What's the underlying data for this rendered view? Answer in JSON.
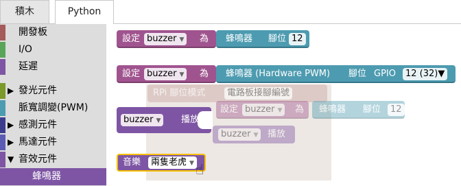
{
  "tabs": {
    "blocks": "積木",
    "python": "Python"
  },
  "toolbox": {
    "items": [
      {
        "label": "開發板",
        "color": "#a55b5b"
      },
      {
        "label": "I/O",
        "color": "#5ba55b"
      },
      {
        "label": "延遲",
        "color": "#7e55a4"
      },
      {
        "label": "發光元件",
        "color": "#7a9a2a",
        "expandable": true,
        "arrow": "▶"
      },
      {
        "label": "脈寬調變(PWM)",
        "color": "#4d9bb0"
      },
      {
        "label": "感測元件",
        "color": "#3d3d8f",
        "expandable": true,
        "arrow": "▶"
      },
      {
        "label": "馬達元件",
        "color": "#5b5bb5",
        "expandable": true,
        "arrow": "▶"
      },
      {
        "label": "音效元件",
        "color": "#7e55a4",
        "expandable": true,
        "arrow": "▼"
      }
    ],
    "selected_sub": "蜂鳴器"
  },
  "workspace": {
    "block1": {
      "set": "設定",
      "var": "buzzer",
      "as": "為",
      "device": "蜂鳴器",
      "pin_label": "腳位",
      "pin": "12"
    },
    "block2": {
      "set": "設定",
      "var": "buzzer",
      "as": "為",
      "device": "蜂鳴器 (Hardware PWM)",
      "pin_label": "腳位",
      "gpio_label": "GPIO",
      "gpio": "12 (32)"
    },
    "block3": {
      "var": "buzzer",
      "action": "播放"
    },
    "block4": {
      "label": "音樂",
      "song": "兩隻老虎"
    },
    "ghost": {
      "title": "RPi 腳位模式",
      "mode": "電路板接腳編號",
      "set": "設定",
      "var": "buzzer",
      "as": "為",
      "device": "蜂鳴器",
      "pin_label": "腳位",
      "pin": "12",
      "play_var": "buzzer",
      "play": "播放"
    }
  },
  "colors": {
    "accent": "#7e55a4",
    "highlight": "#f6c000"
  }
}
